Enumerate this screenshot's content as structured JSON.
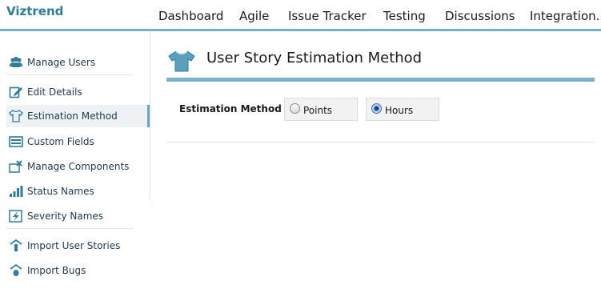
{
  "brand": "Viztrend",
  "nav": [
    "Dashboard",
    "Agile",
    "Issue Tracker",
    "Testing",
    "Discussions",
    "Integration."
  ],
  "sidebar": {
    "items": [
      {
        "label": "Manage Users",
        "icon": "users-icon"
      },
      {
        "label": "Edit Details",
        "icon": "edit-icon"
      },
      {
        "label": "Estimation Method",
        "icon": "tshirt-icon",
        "active": true
      },
      {
        "label": "Custom Fields",
        "icon": "fields-icon"
      },
      {
        "label": "Manage Components",
        "icon": "components-icon"
      },
      {
        "label": "Status Names",
        "icon": "bars-icon"
      },
      {
        "label": "Severity Names",
        "icon": "lightning-icon"
      },
      {
        "label": "Import User Stories",
        "icon": "import-icon"
      },
      {
        "label": "Import Bugs",
        "icon": "bug-import-icon"
      }
    ]
  },
  "main": {
    "title": "User Story Estimation Method",
    "field_label": "Estimation Method",
    "options": [
      {
        "label": "Points",
        "selected": false
      },
      {
        "label": "Hours",
        "selected": true
      }
    ]
  },
  "colors": {
    "accent": "#7ab1c8",
    "brand": "#2f7d98",
    "icon": "#2f7d98"
  }
}
